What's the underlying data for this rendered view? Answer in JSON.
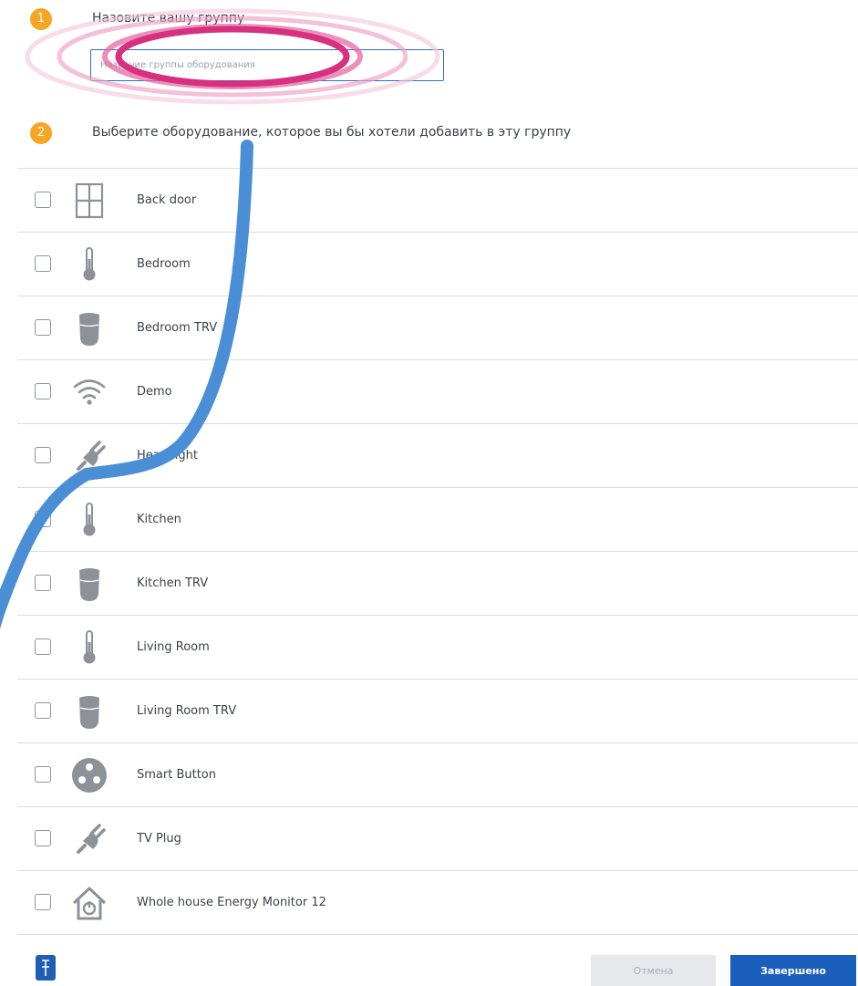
{
  "steps": [
    {
      "number": "1",
      "title": "Назовите вашу группу"
    },
    {
      "number": "2",
      "title": "Выберите оборудование, которое вы бы хотели добавить в эту группу"
    }
  ],
  "group_name_input": {
    "placeholder": "Название группы оборудования",
    "value": ""
  },
  "devices": [
    {
      "label": "Back door",
      "icon": "window-icon",
      "checked": false
    },
    {
      "label": "Bedroom",
      "icon": "thermometer-icon",
      "checked": false
    },
    {
      "label": "Bedroom TRV",
      "icon": "trv-icon",
      "checked": false
    },
    {
      "label": "Demo",
      "icon": "wifi-icon",
      "checked": false
    },
    {
      "label": "Head light",
      "icon": "plug-icon",
      "checked": false
    },
    {
      "label": "Kitchen",
      "icon": "thermometer-icon",
      "checked": false
    },
    {
      "label": "Kitchen TRV",
      "icon": "trv-icon",
      "checked": false
    },
    {
      "label": "Living Room",
      "icon": "thermometer-icon",
      "checked": false
    },
    {
      "label": "Living Room TRV",
      "icon": "trv-icon",
      "checked": false
    },
    {
      "label": "Smart Button",
      "icon": "smart-button-icon",
      "checked": false
    },
    {
      "label": "TV Plug",
      "icon": "plug-icon",
      "checked": false
    },
    {
      "label": "Whole house Energy Monitor 12",
      "icon": "energy-monitor-icon",
      "checked": false
    }
  ],
  "footer": {
    "cancel_label": "Отмена",
    "done_label": "Завершено",
    "pin_icon": "pin-icon"
  },
  "colors": {
    "step_badge": "#f5a623",
    "primary": "#1b5fbd",
    "icon_gray": "#8d9298",
    "highlight_pink": "#d6307e",
    "annotation_blue": "#4a8fd6"
  }
}
